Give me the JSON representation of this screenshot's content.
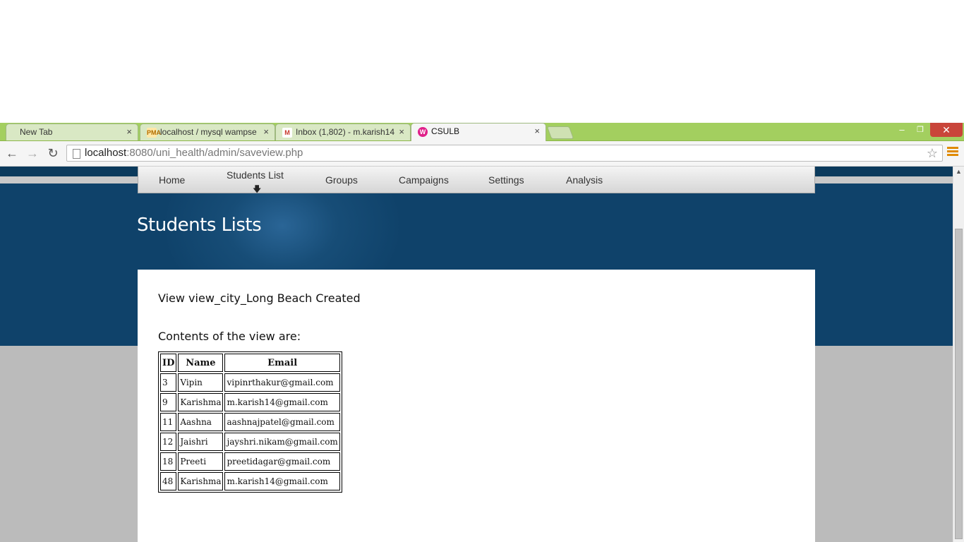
{
  "browser": {
    "tabs": [
      {
        "label": "New Tab",
        "favicon": "",
        "active": false
      },
      {
        "label": "localhost / mysql wampse",
        "favicon": "PMA",
        "active": false
      },
      {
        "label": "Inbox (1,802) - m.karish14",
        "favicon": "M",
        "active": false
      },
      {
        "label": "CSULB",
        "favicon": "W",
        "active": true
      }
    ],
    "close_glyph": "×",
    "window_controls": {
      "minimize": "–",
      "restore": "❐",
      "close": "✕"
    },
    "address": {
      "host": "localhost",
      "path": ":8080/uni_health/admin/saveview.php"
    },
    "icons": {
      "back": "←",
      "forward": "→",
      "reload": "↻",
      "star": "☆"
    }
  },
  "nav": {
    "items": [
      "Home",
      "Students List",
      "Groups",
      "Campaigns",
      "Settings",
      "Analysis"
    ],
    "active_marker": "🡇"
  },
  "page": {
    "title": "Students Lists",
    "message": "View view_city_Long Beach Created",
    "contents_label": "Contents of the view are:"
  },
  "table": {
    "headers": [
      "ID",
      "Name",
      "Email"
    ],
    "rows": [
      [
        "3",
        "Vipin",
        "vipinrthakur@gmail.com"
      ],
      [
        "9",
        "Karishma",
        "m.karish14@gmail.com"
      ],
      [
        "11",
        "Aashna",
        "aashnajpatel@gmail.com"
      ],
      [
        "12",
        "Jaishri",
        "jayshri.nikam@gmail.com"
      ],
      [
        "18",
        "Preeti",
        "preetidagar@gmail.com"
      ],
      [
        "48",
        "Karishma",
        "m.karish14@gmail.com"
      ]
    ]
  },
  "colors": {
    "tabbar": "#a3cf5f",
    "banner": "#0f426a",
    "close_button": "#c9453a"
  }
}
